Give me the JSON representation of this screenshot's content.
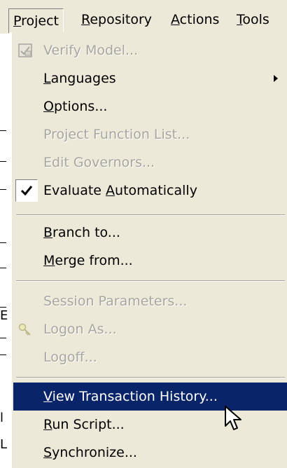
{
  "menubar": {
    "items": [
      {
        "label": "Project",
        "mnemonic_index": 0,
        "open": true
      },
      {
        "label": "Repository",
        "mnemonic_index": 0
      },
      {
        "label": "Actions",
        "mnemonic_index": 0
      },
      {
        "label": "Tools",
        "mnemonic_index": 0
      }
    ]
  },
  "background_fragments": [
    "E",
    "l",
    "L"
  ],
  "dropdown": {
    "items": [
      {
        "label": "Verify Model...",
        "enabled": false,
        "icon": "verify-model-icon"
      },
      {
        "label": "Languages",
        "enabled": true,
        "submenu": true,
        "mnemonic_index": 0
      },
      {
        "label": "Options...",
        "enabled": true,
        "mnemonic_index": 0
      },
      {
        "label": "Project Function List...",
        "enabled": false
      },
      {
        "label": "Edit Governors...",
        "enabled": false
      },
      {
        "label": "Evaluate Automatically",
        "enabled": true,
        "checked": true,
        "mnemonic_index": 9
      },
      {
        "label": "Branch to...",
        "enabled": true,
        "mnemonic_index": 0
      },
      {
        "label": "Merge from...",
        "enabled": true,
        "mnemonic_index": 0
      },
      {
        "label": "Session Parameters...",
        "enabled": false
      },
      {
        "label": "Logon As...",
        "enabled": false,
        "icon": "key-icon"
      },
      {
        "label": "Logoff...",
        "enabled": false
      },
      {
        "label": "View Transaction History...",
        "enabled": true,
        "highlighted": true,
        "mnemonic_index": 0
      },
      {
        "label": "Run Script...",
        "enabled": true,
        "mnemonic_index": 0
      },
      {
        "label": "Synchronize...",
        "enabled": true,
        "mnemonic_index": 0
      }
    ]
  },
  "colors": {
    "menu_background": "#ece9d8",
    "highlight": "#0a246a",
    "disabled_text": "#a7a69f"
  }
}
